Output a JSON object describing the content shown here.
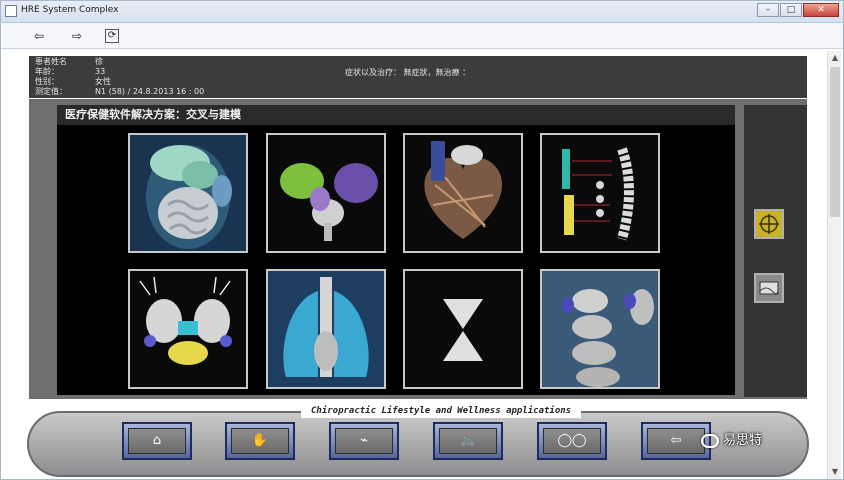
{
  "window": {
    "title": "HRE System Complex",
    "minimize_glyph": "–",
    "maximize_glyph": "□",
    "close_glyph": "✕"
  },
  "toolbar": {
    "back_icon": "⇦",
    "forward_icon": "⇨",
    "refresh_icon": "⟳"
  },
  "patient": {
    "name_label": "患者姓名",
    "name_value": "徐",
    "age_label": "年龄：",
    "age_value": "33",
    "gender_label": "性别：",
    "gender_value": "女性",
    "measure_label": "测定值：",
    "measure_value": "N1 (58)   / 24.8.2013   16 : 00",
    "symptom_text": "症状以及治疗：  無症狀，無治療 ："
  },
  "main": {
    "title": "医疗保健软件解决方案：交叉与建模",
    "thumbnails": [
      {
        "icon": "abdomen-organs"
      },
      {
        "icon": "brain"
      },
      {
        "icon": "heart"
      },
      {
        "icon": "spine-nerves"
      },
      {
        "icon": "kidneys"
      },
      {
        "icon": "lungs"
      },
      {
        "icon": "hourglass"
      },
      {
        "icon": "spine-detail"
      }
    ]
  },
  "side": {
    "btn1_icon": "crosshair-icon",
    "btn2_icon": "image-icon"
  },
  "bottom": {
    "caption": "Chiropractic Lifestyle and Wellness applications",
    "buttons": [
      {
        "icon": "home",
        "glyph": "⌂"
      },
      {
        "icon": "hand",
        "glyph": "✋"
      },
      {
        "icon": "ecg",
        "glyph": "⌁"
      },
      {
        "icon": "bicycle",
        "glyph": "🚲"
      },
      {
        "icon": "circles",
        "glyph": "◯◯"
      },
      {
        "icon": "back",
        "glyph": "⇦"
      }
    ]
  },
  "watermark": {
    "text": "易思特"
  },
  "colors": {
    "panel_dark": "#3c3c3c",
    "image_bg": "#000000",
    "nav_button_border": "#1e2a5a",
    "side_gold": "#c9b22a"
  }
}
